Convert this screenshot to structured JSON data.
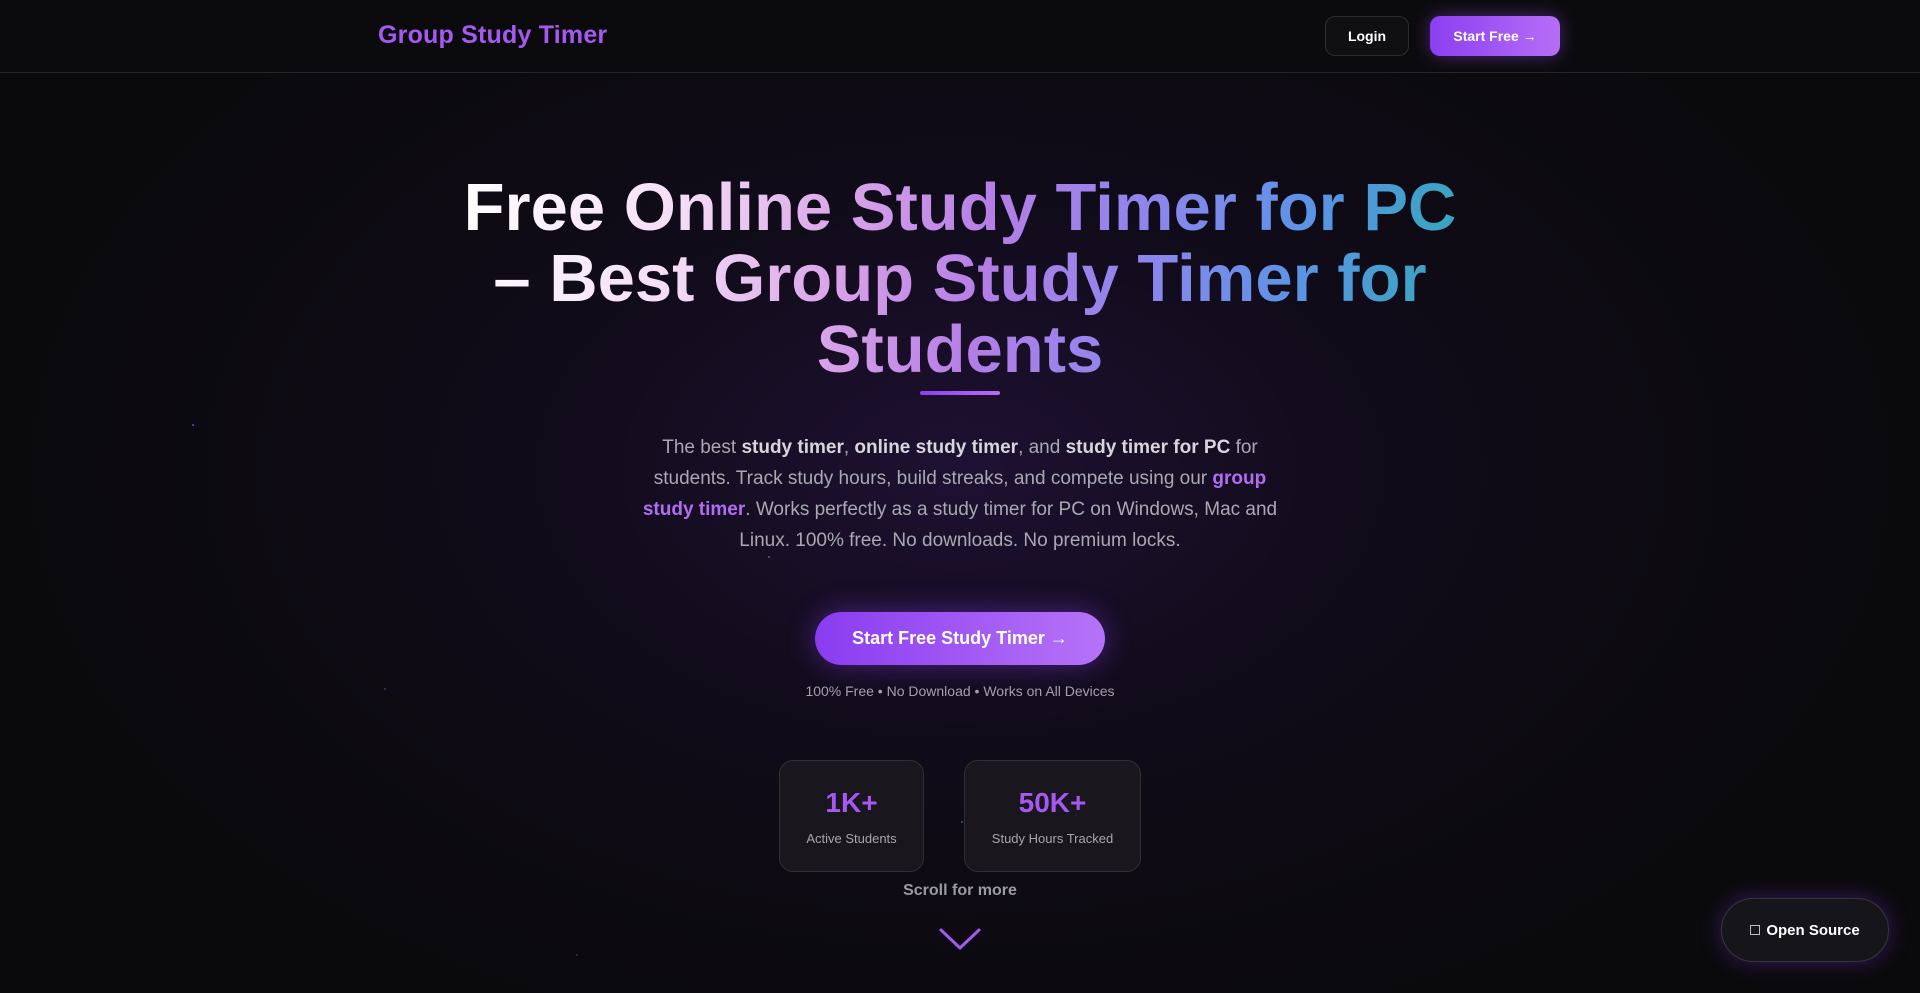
{
  "header": {
    "brand": "Group Study Timer",
    "login_label": "Login",
    "start_label": "Start Free →"
  },
  "hero": {
    "title": "Free Online Study Timer for PC – Best Group Study Timer for Students",
    "description": {
      "p1": "The best ",
      "b1": "study timer",
      "p2": ", ",
      "b2": "online study timer",
      "p3": ", and ",
      "b3": "study timer for PC",
      "p4": " for students. Track study hours, build streaks, and compete using our ",
      "b4": "group study timer",
      "p5": ". Works perfectly as a study timer for PC on Windows, Mac and Linux. 100% free. No downloads. No premium locks."
    },
    "cta_label": "Start Free Study Timer →",
    "cta_note": "100% Free • No Download • Works on All Devices"
  },
  "stats": [
    {
      "value": "1K+",
      "label": "Active Students"
    },
    {
      "value": "50K+",
      "label": "Study Hours Tracked"
    }
  ],
  "scroll": {
    "label": "Scroll for more",
    "icon": "chevron-down-icon"
  },
  "floating": {
    "open_source_label": "Open Source",
    "icon": "code-icon"
  },
  "colors": {
    "accent": "#a559f0",
    "accent_light": "#b66ef7",
    "background": "#0a0a0c"
  }
}
